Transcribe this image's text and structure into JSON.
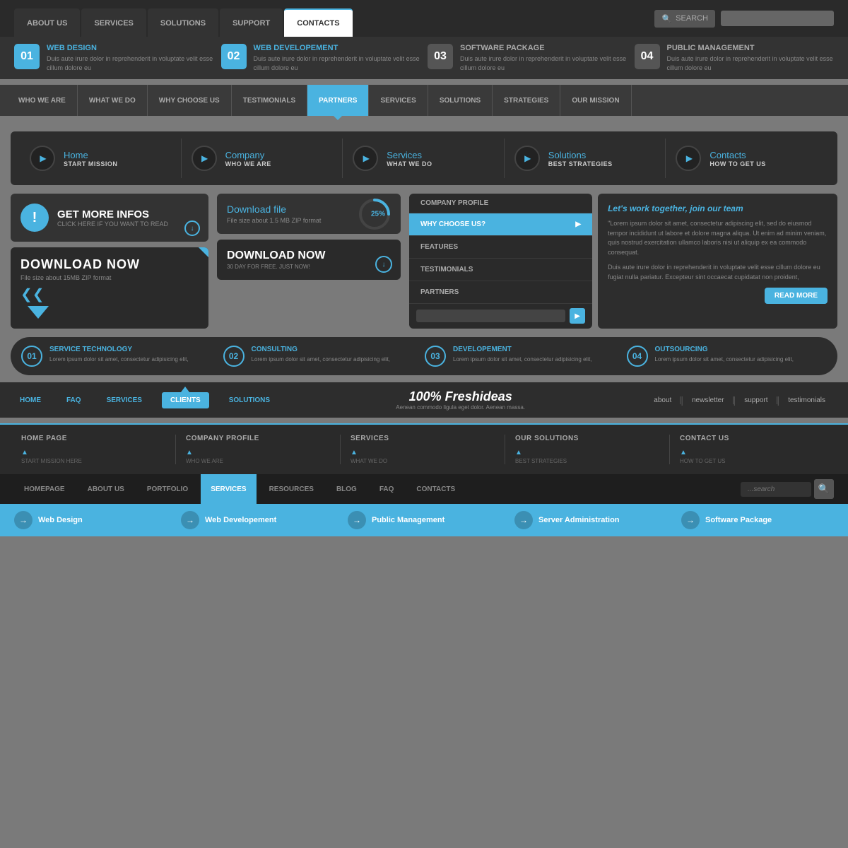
{
  "topnav": {
    "tabs": [
      {
        "label": "ABOUT US",
        "active": false,
        "blue": false
      },
      {
        "label": "SERVICES",
        "active": false,
        "blue": false
      },
      {
        "label": "SOLUTIONS",
        "active": false,
        "blue": false
      },
      {
        "label": "SUPPORT",
        "active": false,
        "blue": false
      },
      {
        "label": "CONTACTS",
        "active": true,
        "blue": false
      }
    ],
    "search_placeholder": "SEARCH"
  },
  "features": [
    {
      "num": "01",
      "title": "WEB DESIGN",
      "desc": "Duis aute irure dolor in reprehenderit in voluptate velit esse cillum dolore eu",
      "blue": true
    },
    {
      "num": "02",
      "title": "WEB DEVELOPEMENT",
      "desc": "Duis aute irure dolor in reprehenderit in voluptate velit esse cillum dolore eu",
      "blue": true
    },
    {
      "num": "03",
      "title": "SOFTWARE PACKAGE",
      "desc": "Duis aute irure dolor in reprehenderit in voluptate velit esse cillum dolore eu",
      "blue": false
    },
    {
      "num": "04",
      "title": "PUBLIC MANAGEMENT",
      "desc": "Duis aute irure dolor in reprehenderit in voluptate velit esse cillum dolore eu",
      "blue": false
    }
  ],
  "secondaryNav": {
    "items": [
      {
        "label": "WHO WE ARE",
        "active": false
      },
      {
        "label": "WHAT WE DO",
        "active": false
      },
      {
        "label": "WHY CHOOSE US",
        "active": false
      },
      {
        "label": "TESTIMONIALS",
        "active": false
      },
      {
        "label": "PARTNERS",
        "active": true
      },
      {
        "label": "SERVICES",
        "active": false
      },
      {
        "label": "SOLUTIONS",
        "active": false
      },
      {
        "label": "STRATEGIES",
        "active": false
      },
      {
        "label": "OUR MISSION",
        "active": false
      }
    ]
  },
  "iconNav": {
    "items": [
      {
        "main": "Home",
        "sub": "START MISSION"
      },
      {
        "main": "Company",
        "sub": "WHO WE ARE"
      },
      {
        "main": "Services",
        "sub": "WHAT WE DO"
      },
      {
        "main": "Solutions",
        "sub": "BEST STRATEGIES"
      },
      {
        "main": "Contacts",
        "sub": "HOW TO GET US"
      }
    ]
  },
  "actions": {
    "get_more": {
      "title": "GET MORE INFOS",
      "subtitle": "CLICK HERE IF YOU WANT TO READ"
    },
    "download_now1": {
      "title": "DOWNLOAD NOW",
      "subtitle": "File size about 15MB ZIP format"
    },
    "download_file": {
      "title": "Download file",
      "subtitle": "File size about 1.5 MB ZIP format",
      "progress": 25
    },
    "download_now2": {
      "title": "DOWNLOAD NOW",
      "subtitle": "30 DAY FOR FREE. JUST NOW!"
    }
  },
  "companyProfile": {
    "title": "COMPANY PROFILE",
    "items": [
      {
        "label": "WHY CHOOSE US?",
        "active": true
      },
      {
        "label": "FEATURES",
        "active": false
      },
      {
        "label": "TESTIMONIALS",
        "active": false
      },
      {
        "label": "PARTNERS",
        "active": false
      }
    ],
    "search_placeholder": ""
  },
  "joinTeam": {
    "title": "Let's work together, join our team",
    "body1": "\"Lorem ipsum dolor sit amet, consectetur adipiscing elit, sed do eiusmod tempor incididunt ut labore et dolore magna aliqua. Ut enim ad minim veniam, quis nostrud exercitation ullamco laboris nisi ut aliquip ex ea commodo consequat.",
    "body2": "Duis aute irure dolor in reprehenderit in voluptate velit esse cillum dolore eu fugiat nulla pariatur. Excepteur sint occaecat cupidatat non proident,",
    "button": "READ MORE"
  },
  "services": [
    {
      "num": "01",
      "title": "SERVICE TECHNOLOGY",
      "desc": "Lorem ipsum dolor sit amet, consectetur adipisicing elit,"
    },
    {
      "num": "02",
      "title": "CONSULTING",
      "desc": "Lorem ipsum dolor sit amet, consectetur adipisicing elit,"
    },
    {
      "num": "03",
      "title": "DEVELOPEMENT",
      "desc": "Lorem ipsum dolor sit amet, consectetur adipisicing elit,"
    },
    {
      "num": "04",
      "title": "OUTSOURCING",
      "desc": "Lorem ipsum dolor sit amet, consectetur adipisicing elit,"
    }
  ],
  "footerNav": {
    "left_items": [
      {
        "label": "HOME",
        "active": false
      },
      {
        "label": "FAQ",
        "active": false
      },
      {
        "label": "SERVICES",
        "active": false
      },
      {
        "label": "CLIENTS",
        "active": true
      },
      {
        "label": "SOLUTIONS",
        "active": false
      }
    ],
    "brand": "100% Freshideas",
    "brand_sub": "Aenean commodo ligula eget dolor. Aenean massa.",
    "right_items": [
      {
        "label": "about"
      },
      {
        "label": "newsletter"
      },
      {
        "label": "support"
      },
      {
        "label": "testimonials"
      }
    ]
  },
  "sitemap": [
    {
      "title": "HOME PAGE",
      "sub": "START MISSION HERE"
    },
    {
      "title": "COMPANY PROFILE",
      "sub": "WHO WE ARE"
    },
    {
      "title": "SERVICES",
      "sub": "WHAT WE DO"
    },
    {
      "title": "OUR SOLUTIONS",
      "sub": "BEST STRATEGIES"
    },
    {
      "title": "CONTACT US",
      "sub": "HOW TO GET US"
    }
  ],
  "darkBottomNav": {
    "items": [
      {
        "label": "HOMEPAGE",
        "active": false
      },
      {
        "label": "ABOUT US",
        "active": false
      },
      {
        "label": "PORTFOLIO",
        "active": false
      },
      {
        "label": "SERVICES",
        "active": true
      },
      {
        "label": "RESOURCES",
        "active": false
      },
      {
        "label": "BLOG",
        "active": false
      },
      {
        "label": "FAQ",
        "active": false
      },
      {
        "label": "CONTACTS",
        "active": false
      }
    ],
    "search_placeholder": "...search"
  },
  "blueLinkBar": {
    "items": [
      "Web Design",
      "Web Developement",
      "Public Management",
      "Server Administration",
      "Software Package"
    ]
  }
}
